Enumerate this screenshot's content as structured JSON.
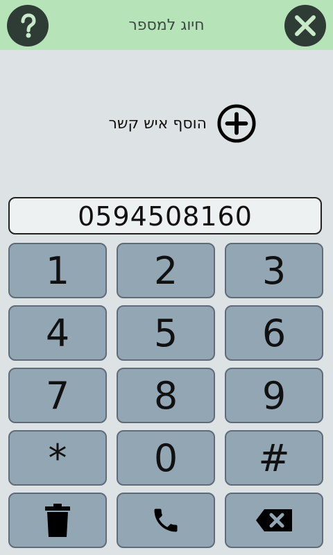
{
  "header": {
    "title": "חיוג למספר",
    "help_icon": "question-mark-icon",
    "close_icon": "close-x-icon"
  },
  "add_contact": {
    "label": "הוסף איש קשר",
    "icon": "plus-circle-icon"
  },
  "dial_field": {
    "value": "0594508160"
  },
  "keypad": {
    "keys": [
      "1",
      "2",
      "3",
      "4",
      "5",
      "6",
      "7",
      "8",
      "9",
      "*",
      "0",
      "#"
    ],
    "bottom_row_icons": [
      "trash-icon",
      "phone-icon",
      "backspace-icon"
    ]
  },
  "colors": {
    "header_bg": "#b6e4b8",
    "page_bg": "#dde3e4",
    "key_bg": "#93a6b4",
    "key_border": "#5f6c78",
    "icon_dark": "#2f3b35"
  }
}
